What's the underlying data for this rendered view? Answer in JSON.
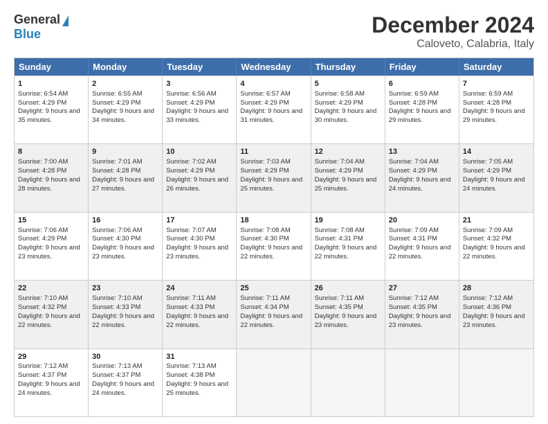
{
  "header": {
    "logo": {
      "general": "General",
      "blue": "Blue"
    },
    "title": "December 2024",
    "location": "Caloveto, Calabria, Italy"
  },
  "calendar": {
    "days": [
      "Sunday",
      "Monday",
      "Tuesday",
      "Wednesday",
      "Thursday",
      "Friday",
      "Saturday"
    ],
    "rows": [
      [
        {
          "day": "1",
          "sunrise": "Sunrise: 6:54 AM",
          "sunset": "Sunset: 4:29 PM",
          "daylight": "Daylight: 9 hours and 35 minutes."
        },
        {
          "day": "2",
          "sunrise": "Sunrise: 6:55 AM",
          "sunset": "Sunset: 4:29 PM",
          "daylight": "Daylight: 9 hours and 34 minutes."
        },
        {
          "day": "3",
          "sunrise": "Sunrise: 6:56 AM",
          "sunset": "Sunset: 4:29 PM",
          "daylight": "Daylight: 9 hours and 33 minutes."
        },
        {
          "day": "4",
          "sunrise": "Sunrise: 6:57 AM",
          "sunset": "Sunset: 4:29 PM",
          "daylight": "Daylight: 9 hours and 31 minutes."
        },
        {
          "day": "5",
          "sunrise": "Sunrise: 6:58 AM",
          "sunset": "Sunset: 4:29 PM",
          "daylight": "Daylight: 9 hours and 30 minutes."
        },
        {
          "day": "6",
          "sunrise": "Sunrise: 6:59 AM",
          "sunset": "Sunset: 4:28 PM",
          "daylight": "Daylight: 9 hours and 29 minutes."
        },
        {
          "day": "7",
          "sunrise": "Sunrise: 6:59 AM",
          "sunset": "Sunset: 4:28 PM",
          "daylight": "Daylight: 9 hours and 29 minutes."
        }
      ],
      [
        {
          "day": "8",
          "sunrise": "Sunrise: 7:00 AM",
          "sunset": "Sunset: 4:28 PM",
          "daylight": "Daylight: 9 hours and 28 minutes."
        },
        {
          "day": "9",
          "sunrise": "Sunrise: 7:01 AM",
          "sunset": "Sunset: 4:28 PM",
          "daylight": "Daylight: 9 hours and 27 minutes."
        },
        {
          "day": "10",
          "sunrise": "Sunrise: 7:02 AM",
          "sunset": "Sunset: 4:29 PM",
          "daylight": "Daylight: 9 hours and 26 minutes."
        },
        {
          "day": "11",
          "sunrise": "Sunrise: 7:03 AM",
          "sunset": "Sunset: 4:29 PM",
          "daylight": "Daylight: 9 hours and 25 minutes."
        },
        {
          "day": "12",
          "sunrise": "Sunrise: 7:04 AM",
          "sunset": "Sunset: 4:29 PM",
          "daylight": "Daylight: 9 hours and 25 minutes."
        },
        {
          "day": "13",
          "sunrise": "Sunrise: 7:04 AM",
          "sunset": "Sunset: 4:29 PM",
          "daylight": "Daylight: 9 hours and 24 minutes."
        },
        {
          "day": "14",
          "sunrise": "Sunrise: 7:05 AM",
          "sunset": "Sunset: 4:29 PM",
          "daylight": "Daylight: 9 hours and 24 minutes."
        }
      ],
      [
        {
          "day": "15",
          "sunrise": "Sunrise: 7:06 AM",
          "sunset": "Sunset: 4:29 PM",
          "daylight": "Daylight: 9 hours and 23 minutes."
        },
        {
          "day": "16",
          "sunrise": "Sunrise: 7:06 AM",
          "sunset": "Sunset: 4:30 PM",
          "daylight": "Daylight: 9 hours and 23 minutes."
        },
        {
          "day": "17",
          "sunrise": "Sunrise: 7:07 AM",
          "sunset": "Sunset: 4:30 PM",
          "daylight": "Daylight: 9 hours and 23 minutes."
        },
        {
          "day": "18",
          "sunrise": "Sunrise: 7:08 AM",
          "sunset": "Sunset: 4:30 PM",
          "daylight": "Daylight: 9 hours and 22 minutes."
        },
        {
          "day": "19",
          "sunrise": "Sunrise: 7:08 AM",
          "sunset": "Sunset: 4:31 PM",
          "daylight": "Daylight: 9 hours and 22 minutes."
        },
        {
          "day": "20",
          "sunrise": "Sunrise: 7:09 AM",
          "sunset": "Sunset: 4:31 PM",
          "daylight": "Daylight: 9 hours and 22 minutes."
        },
        {
          "day": "21",
          "sunrise": "Sunrise: 7:09 AM",
          "sunset": "Sunset: 4:32 PM",
          "daylight": "Daylight: 9 hours and 22 minutes."
        }
      ],
      [
        {
          "day": "22",
          "sunrise": "Sunrise: 7:10 AM",
          "sunset": "Sunset: 4:32 PM",
          "daylight": "Daylight: 9 hours and 22 minutes."
        },
        {
          "day": "23",
          "sunrise": "Sunrise: 7:10 AM",
          "sunset": "Sunset: 4:33 PM",
          "daylight": "Daylight: 9 hours and 22 minutes."
        },
        {
          "day": "24",
          "sunrise": "Sunrise: 7:11 AM",
          "sunset": "Sunset: 4:33 PM",
          "daylight": "Daylight: 9 hours and 22 minutes."
        },
        {
          "day": "25",
          "sunrise": "Sunrise: 7:11 AM",
          "sunset": "Sunset: 4:34 PM",
          "daylight": "Daylight: 9 hours and 22 minutes."
        },
        {
          "day": "26",
          "sunrise": "Sunrise: 7:11 AM",
          "sunset": "Sunset: 4:35 PM",
          "daylight": "Daylight: 9 hours and 23 minutes."
        },
        {
          "day": "27",
          "sunrise": "Sunrise: 7:12 AM",
          "sunset": "Sunset: 4:35 PM",
          "daylight": "Daylight: 9 hours and 23 minutes."
        },
        {
          "day": "28",
          "sunrise": "Sunrise: 7:12 AM",
          "sunset": "Sunset: 4:36 PM",
          "daylight": "Daylight: 9 hours and 23 minutes."
        }
      ],
      [
        {
          "day": "29",
          "sunrise": "Sunrise: 7:12 AM",
          "sunset": "Sunset: 4:37 PM",
          "daylight": "Daylight: 9 hours and 24 minutes."
        },
        {
          "day": "30",
          "sunrise": "Sunrise: 7:13 AM",
          "sunset": "Sunset: 4:37 PM",
          "daylight": "Daylight: 9 hours and 24 minutes."
        },
        {
          "day": "31",
          "sunrise": "Sunrise: 7:13 AM",
          "sunset": "Sunset: 4:38 PM",
          "daylight": "Daylight: 9 hours and 25 minutes."
        },
        null,
        null,
        null,
        null
      ]
    ]
  }
}
